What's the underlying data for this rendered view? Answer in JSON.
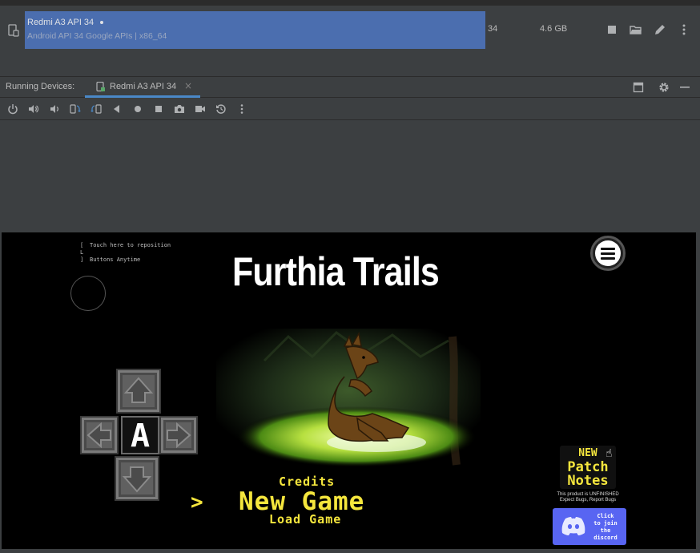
{
  "device_manager": {
    "device_name": "Redmi A3 API 34",
    "device_subtitle": "Android API 34 Google APIs | x86_64",
    "api_level": "34",
    "size": "4.6 GB",
    "row_highlight_color": "#4b6eaf",
    "actions": [
      "stop-icon",
      "folder-icon",
      "edit-icon",
      "more-vertical-icon"
    ]
  },
  "running_devices": {
    "label": "Running Devices:",
    "tab_label": "Redmi A3 API 34",
    "tab_close": "×",
    "window_actions": [
      "maximize-icon",
      "gear-icon",
      "minimize-icon"
    ]
  },
  "emulator_toolbar": {
    "buttons": [
      "power-icon",
      "volume-up-icon",
      "volume-down-icon",
      "rotate-left-icon",
      "rotate-right-icon",
      "back-icon",
      "home-icon",
      "overview-icon",
      "screenshot-icon",
      "screen-record-icon",
      "snapshot-icon",
      "more-vertical-icon"
    ]
  },
  "game": {
    "hint_line1": "Touch here to reposition",
    "hint_line2": "Buttons Anytime",
    "title": "Furthia Trails",
    "menu_credits": "Credits",
    "menu_new_game": "New Game",
    "menu_load_game": "Load Game",
    "cursor": ">",
    "a_button": "A",
    "patch_new": "NEW",
    "patch_line2": "Patch",
    "patch_line3": "Notes",
    "unfinished_line1": "This product is UNFINISHED",
    "unfinished_line2": "Expect Bugs, Report Bugs",
    "discord_text_1": "Click",
    "discord_text_2": "to join",
    "discord_text_3": "the",
    "discord_text_4": "discord",
    "accent_color": "#f5e63d",
    "discord_color": "#5865f2"
  }
}
